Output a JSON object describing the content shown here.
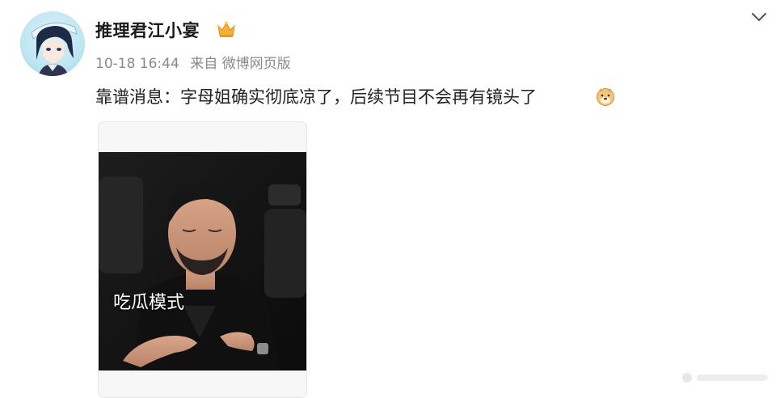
{
  "post": {
    "author": {
      "name": "推理君江小宴",
      "avatar_icon": "avatar-anime-character",
      "badge_icon": "crown-icon"
    },
    "meta": {
      "time": "10-18 16:44",
      "source": "来自 微博网页版"
    },
    "text": "靠谱消息：字母姐确实彻底凉了，后续节目不会再有镜头了",
    "emoji_icon": "doge-emoji-icon",
    "menu_icon": "chevron-down-icon",
    "media": {
      "caption": "吃瓜模式"
    }
  },
  "colors": {
    "text": "#222222",
    "meta": "#8a8a8a",
    "crown": "#f5b335",
    "avatar_bg": "#bfe6f3",
    "media_bg": "#141414"
  }
}
